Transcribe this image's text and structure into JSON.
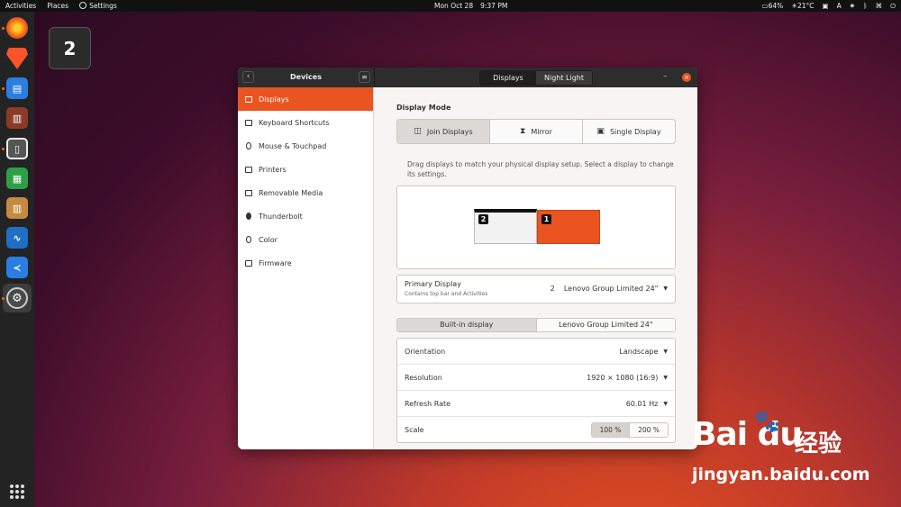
{
  "topbar": {
    "activities": "Activities",
    "places": "Places",
    "settings": "Settings",
    "date": "Mon Oct 28",
    "time": "9:37 PM",
    "battery": "64%",
    "temperature": "21°C",
    "input_method": "A"
  },
  "workspace_badge": "2",
  "window": {
    "sidebar_title": "Devices",
    "tabs": [
      {
        "label": "Displays",
        "active": true
      },
      {
        "label": "Night Light",
        "active": false
      }
    ],
    "close_glyph": "×",
    "minimize_glyph": "–"
  },
  "sidebar": {
    "items": [
      {
        "label": "Displays",
        "icon": "display-icon",
        "active": true
      },
      {
        "label": "Keyboard Shortcuts",
        "icon": "keyboard-icon",
        "active": false
      },
      {
        "label": "Mouse & Touchpad",
        "icon": "mouse-icon",
        "active": false
      },
      {
        "label": "Printers",
        "icon": "printer-icon",
        "active": false
      },
      {
        "label": "Removable Media",
        "icon": "media-icon",
        "active": false
      },
      {
        "label": "Thunderbolt",
        "icon": "thunderbolt-icon",
        "active": false
      },
      {
        "label": "Color",
        "icon": "color-icon",
        "active": false
      },
      {
        "label": "Firmware",
        "icon": "firmware-icon",
        "active": false
      }
    ]
  },
  "display_mode": {
    "title": "Display Mode",
    "options": [
      {
        "label": "Join Displays",
        "active": true
      },
      {
        "label": "Mirror",
        "active": false
      },
      {
        "label": "Single Display",
        "active": false
      }
    ],
    "hint": "Drag displays to match your physical display setup. Select a display to change its settings.",
    "monitor_2_label": "2",
    "monitor_1_label": "1"
  },
  "primary_display": {
    "label": "Primary Display",
    "sublabel": "Contains top bar and Activities",
    "number": "2",
    "value": "Lenovo Group Limited 24\""
  },
  "display_tabs": [
    {
      "label": "Built-in display",
      "active": true
    },
    {
      "label": "Lenovo Group Limited 24\"",
      "active": false
    }
  ],
  "settings": {
    "orientation": {
      "label": "Orientation",
      "value": "Landscape"
    },
    "resolution": {
      "label": "Resolution",
      "value": "1920 × 1080 (16:9)"
    },
    "refresh_rate": {
      "label": "Refresh Rate",
      "value": "60.01 Hz"
    },
    "scale": {
      "label": "Scale",
      "options": [
        "100 %",
        "200 %"
      ],
      "selected": "100 %"
    }
  },
  "watermark": {
    "logo": "Bai du",
    "brand": "经验",
    "url": "jingyan.baidu.com"
  },
  "colors": {
    "accent": "#e95420",
    "header": "#2d2d2d",
    "dock": "#232323"
  }
}
